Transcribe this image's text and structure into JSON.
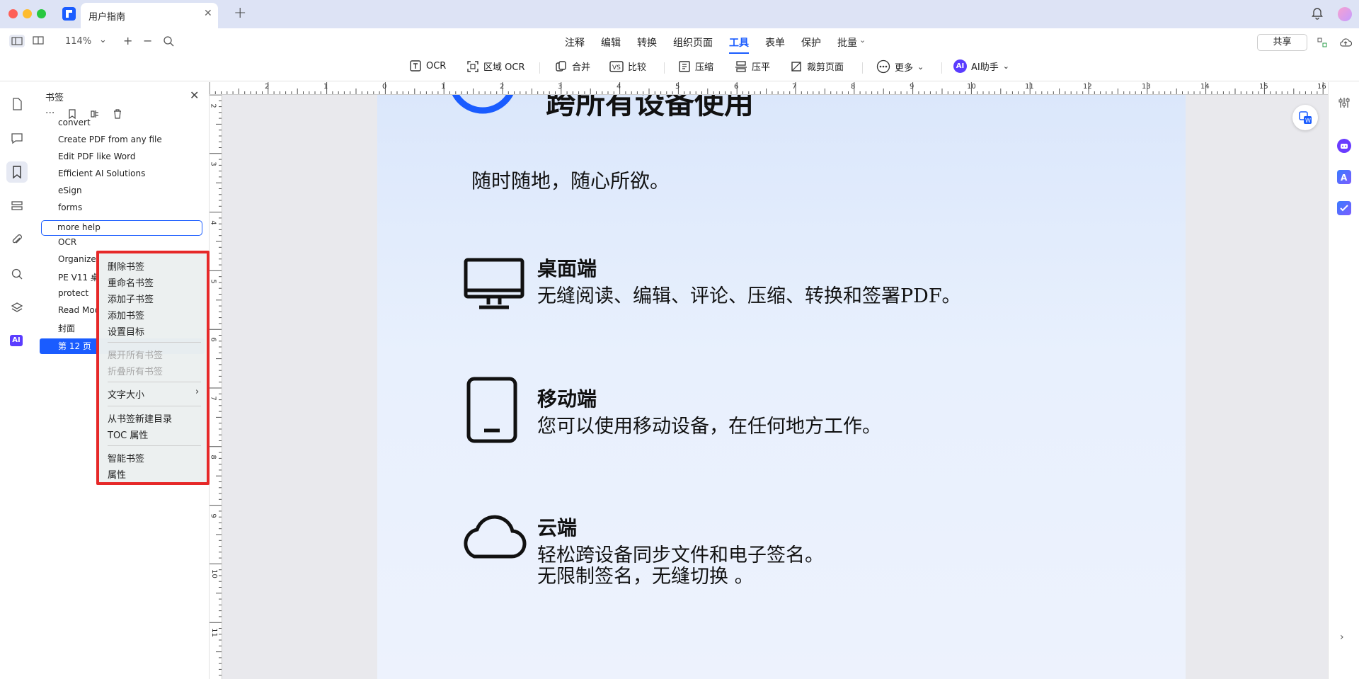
{
  "window": {
    "tab_title": "用户指南"
  },
  "toolbar": {
    "zoom": "114%",
    "main_menu": [
      "注释",
      "编辑",
      "转换",
      "组织页面",
      "工具",
      "表单",
      "保护",
      "批量"
    ],
    "active_menu": "工具",
    "share_label": "共享",
    "tools": {
      "ocr": "OCR",
      "area_ocr": "区域 OCR",
      "merge": "合并",
      "compare": "比较",
      "compress": "压缩",
      "flatten": "压平",
      "crop": "裁剪页面",
      "more": "更多",
      "ai": "AI助手",
      "ai_badge": "AI"
    }
  },
  "rail": {
    "ai_label": "AI"
  },
  "bookmarks": {
    "title": "书签",
    "items": [
      "convert",
      "Create PDF from any file",
      "Edit PDF like Word",
      "Efficient AI Solutions",
      "eSign",
      "forms",
      "more help",
      "OCR",
      "Organize",
      "PE V11 桌",
      "protect",
      "Read Mode",
      "封面",
      "第 12 页"
    ]
  },
  "context_menu": {
    "items": [
      {
        "label": "删除书签",
        "enabled": true
      },
      {
        "label": "重命名书签",
        "enabled": true
      },
      {
        "label": "添加子书签",
        "enabled": true
      },
      {
        "label": "添加书签",
        "enabled": true
      },
      {
        "label": "设置目标",
        "enabled": true
      },
      {
        "label": "展开所有书签",
        "enabled": false
      },
      {
        "label": "折叠所有书签",
        "enabled": false
      },
      {
        "label": "文字大小",
        "enabled": true,
        "submenu": true
      },
      {
        "label": "从书签新建目录",
        "enabled": true
      },
      {
        "label": "TOC 属性",
        "enabled": true
      },
      {
        "label": "智能书签",
        "enabled": true
      },
      {
        "label": "属性",
        "enabled": true
      }
    ]
  },
  "ruler": {
    "h": [
      "2",
      "1",
      "0",
      "1",
      "2",
      "3",
      "4",
      "5",
      "6",
      "7",
      "8",
      "9",
      "10",
      "11",
      "12",
      "13",
      "14",
      "15",
      "16"
    ],
    "v": [
      "2",
      "3",
      "4",
      "5",
      "6",
      "7",
      "8",
      "9",
      "10",
      "11"
    ]
  },
  "document": {
    "top_heading": "跨所有设备使用",
    "tagline": "随时随地，随心所欲。",
    "sections": [
      {
        "title": "桌面端",
        "body": [
          "无缝阅读、编辑、评论、压缩、转换和签署PDF。"
        ]
      },
      {
        "title": "移动端",
        "body": [
          "您可以使用移动设备，在任何地方工作。"
        ]
      },
      {
        "title": "云端",
        "body": [
          "轻松跨设备同步文件和电子签名。",
          "无限制签名，无缝切换 。"
        ]
      }
    ]
  },
  "colors": {
    "accent": "#1a5cff",
    "highlight_border": "#e62828"
  }
}
